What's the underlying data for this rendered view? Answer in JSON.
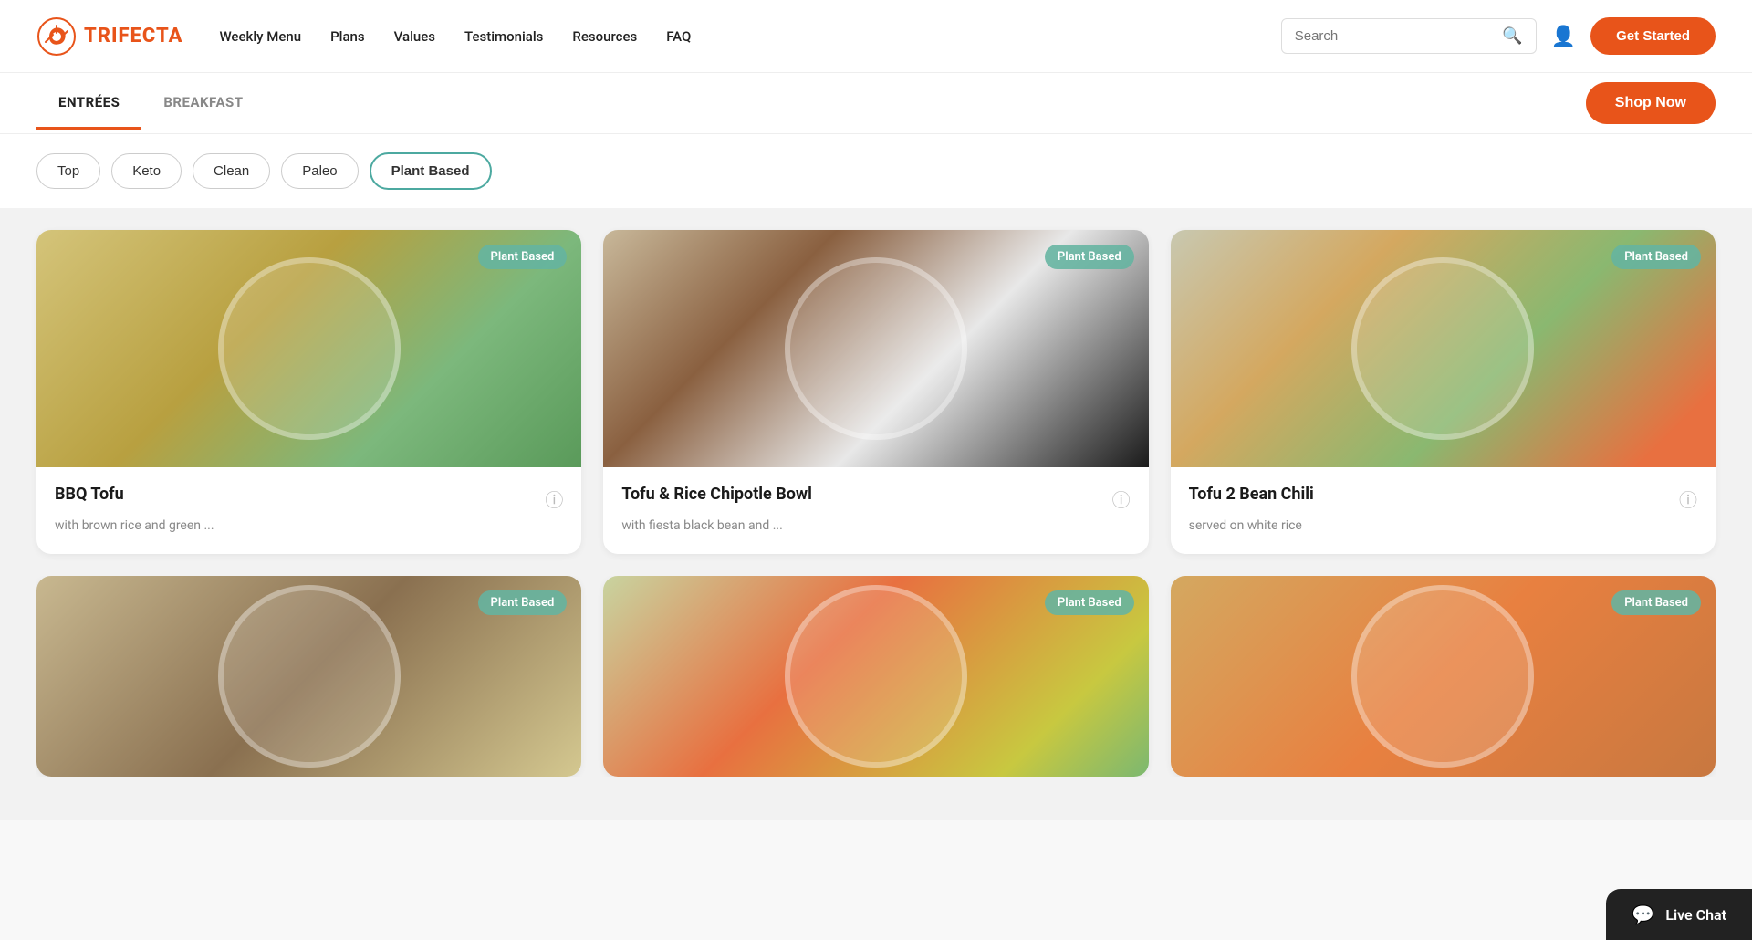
{
  "header": {
    "logo_text": "TRIFECTA",
    "nav_items": [
      {
        "label": "Weekly Menu",
        "href": "#"
      },
      {
        "label": "Plans",
        "href": "#"
      },
      {
        "label": "Values",
        "href": "#"
      },
      {
        "label": "Testimonials",
        "href": "#"
      },
      {
        "label": "Resources",
        "href": "#"
      },
      {
        "label": "FAQ",
        "href": "#"
      }
    ],
    "search_placeholder": "Search",
    "get_started_label": "Get Started"
  },
  "tabs_section": {
    "tabs": [
      {
        "label": "ENTRÉES",
        "active": true
      },
      {
        "label": "BREAKFAST",
        "active": false
      }
    ],
    "shop_now_label": "Shop Now"
  },
  "filters": {
    "pills": [
      {
        "label": "Top",
        "active": false
      },
      {
        "label": "Keto",
        "active": false
      },
      {
        "label": "Clean",
        "active": false
      },
      {
        "label": "Paleo",
        "active": false
      },
      {
        "label": "Plant Based",
        "active": true
      }
    ]
  },
  "cards": [
    {
      "badge": "Plant Based",
      "title": "BBQ Tofu",
      "description": "with brown rice and green ...",
      "plate_class": "plate-tofu"
    },
    {
      "badge": "Plant Based",
      "title": "Tofu & Rice Chipotle Bowl",
      "description": "with fiesta black bean and ...",
      "plate_class": "plate-tofu-rice"
    },
    {
      "badge": "Plant Based",
      "title": "Tofu 2 Bean Chili",
      "description": "served on white rice",
      "plate_class": "plate-chili"
    }
  ],
  "cards_bottom": [
    {
      "badge": "Plant Based",
      "title": "",
      "description": "",
      "plate_class": "plate-bottom1"
    },
    {
      "badge": "Plant Based",
      "title": "",
      "description": "",
      "plate_class": "plate-bottom2"
    },
    {
      "badge": "Plant Based",
      "title": "",
      "description": "",
      "plate_class": "plate-bottom3"
    }
  ],
  "live_chat": {
    "label": "Live Chat"
  }
}
